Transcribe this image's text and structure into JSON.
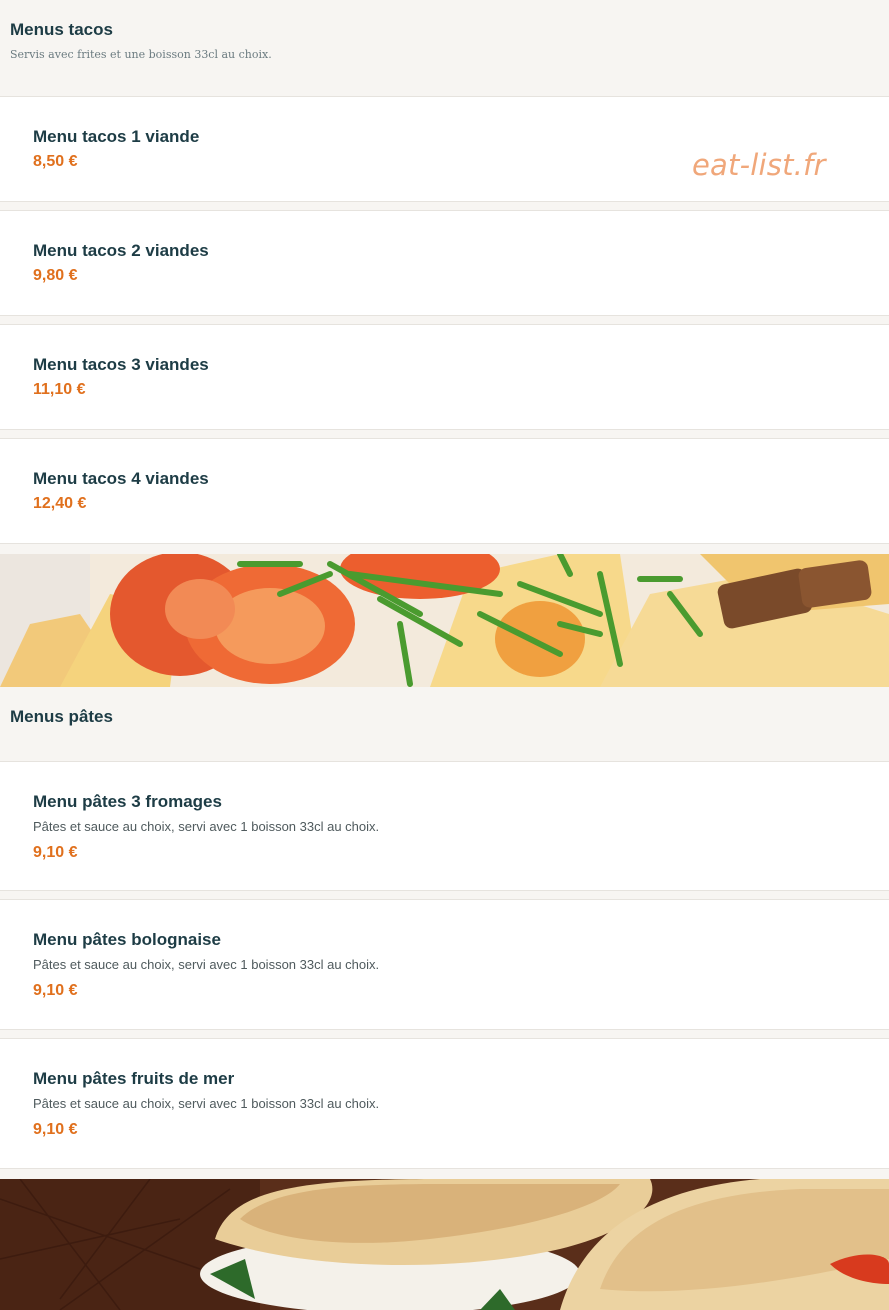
{
  "sections": [
    {
      "title": "Menus tacos",
      "subtitle": "Servis avec frites et une boisson 33cl au choix.",
      "items": [
        {
          "name": "Menu tacos 1 viande",
          "price": "8,50 €"
        },
        {
          "name": "Menu tacos 2 viandes",
          "price": "9,80 €"
        },
        {
          "name": "Menu tacos 3 viandes",
          "price": "11,10 €"
        },
        {
          "name": "Menu tacos 4 viandes",
          "price": "12,40 €"
        }
      ]
    },
    {
      "title": "Menus pâtes",
      "items": [
        {
          "name": "Menu pâtes 3 fromages",
          "description": "Pâtes et sauce au choix, servi avec 1 boisson 33cl au choix.",
          "price": "9,10 €"
        },
        {
          "name": "Menu pâtes bolognaise",
          "description": "Pâtes et sauce au choix, servi avec 1 boisson 33cl au choix.",
          "price": "9,10 €"
        },
        {
          "name": "Menu pâtes fruits de mer",
          "description": "Pâtes et sauce au choix, servi avec 1 boisson 33cl au choix.",
          "price": "9,10 €"
        }
      ]
    }
  ],
  "watermark": "eat-list.fr",
  "colors": {
    "price": "#e0701d",
    "title": "#1d3c45",
    "background": "#f7f5f2",
    "watermark": "#f0a77a"
  }
}
